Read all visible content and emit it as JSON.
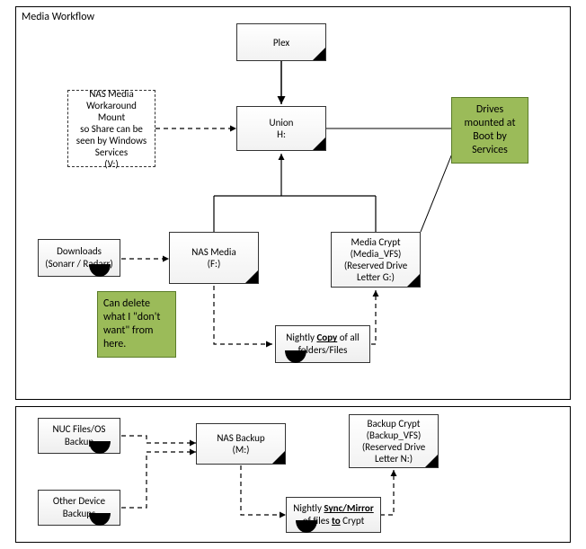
{
  "title": "Media Workflow",
  "nodes": {
    "plex": "Plex",
    "union": "Union",
    "union_drive": "H:",
    "nas_mount_l1": "NAS Media",
    "nas_mount_l2": "Workaround Mount",
    "nas_mount_l3": "so Share can be",
    "nas_mount_l4": "seen by Windows",
    "nas_mount_l5": "Services",
    "nas_mount_l6": "(V:)",
    "downloads_l1": "Downloads",
    "downloads_l2": "(Sonarr / Radarr)",
    "nas_media_l1": "NAS Media",
    "nas_media_l2": "(F:)",
    "media_crypt_l1": "Media Crypt",
    "media_crypt_l2": "(Media_VFS)",
    "media_crypt_l3": "(Reserved Drive",
    "media_crypt_l4": "Letter G:)",
    "nightly_copy_pre": "Nightly ",
    "nightly_copy_word": "Copy",
    "nightly_copy_post": " of all folders/Files",
    "nuc_l1": "NUC Files/OS",
    "nuc_l2": "Backup",
    "other_l1": "Other Device",
    "other_l2": "Backups",
    "nas_backup_l1": "NAS Backup",
    "nas_backup_l2": "(M:)",
    "backup_crypt_l1": "Backup Crypt",
    "backup_crypt_l2": "(Backup_VFS)",
    "backup_crypt_l3": "(Reserved Drive",
    "backup_crypt_l4": "Letter N:)",
    "nightly_sync_pre": "Nightly ",
    "nightly_sync_word": "Sync/Mirror",
    "nightly_sync_mid": " of files ",
    "nightly_sync_to": "to",
    "nightly_sync_post": " Crypt"
  },
  "callouts": {
    "drives_l1": "Drives",
    "drives_l2": "mounted at",
    "drives_l3": "Boot by",
    "drives_l4": "Services",
    "delete_l1": "Can delete",
    "delete_l2": "what I \"don't",
    "delete_l3": "want\" from",
    "delete_l4": "here."
  }
}
